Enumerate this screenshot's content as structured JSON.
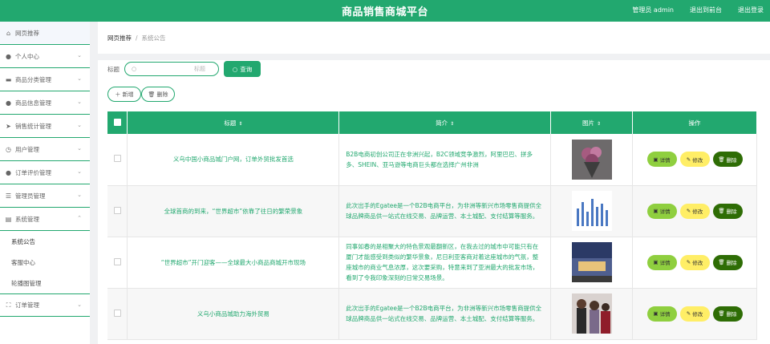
{
  "header": {
    "title": "商品销售商城平台",
    "admin": "管理员 admin",
    "exit_to_front": "退出到前台",
    "logout": "退出登录"
  },
  "sidebar": {
    "items": [
      {
        "label": "网页推荐",
        "icon": "home-icon",
        "has_chevron": false
      },
      {
        "label": "个人中心",
        "icon": "user-icon",
        "has_chevron": true
      },
      {
        "label": "商品分类管理",
        "icon": "category-icon",
        "has_chevron": true
      },
      {
        "label": "商品信息管理",
        "icon": "user-icon",
        "has_chevron": true
      },
      {
        "label": "销售统计管理",
        "icon": "send-icon",
        "has_chevron": true
      },
      {
        "label": "用户管理",
        "icon": "clock-icon",
        "has_chevron": true
      },
      {
        "label": "订单评价管理",
        "icon": "user-icon",
        "has_chevron": true
      },
      {
        "label": "管理员管理",
        "icon": "list-icon",
        "has_chevron": true
      },
      {
        "label": "系统管理",
        "icon": "doc-icon",
        "has_chevron": true,
        "expanded": true
      },
      {
        "label": "订单管理",
        "icon": "expand-icon",
        "has_chevron": true
      }
    ],
    "sub_items": [
      "系统公告",
      "客服中心",
      "轮播图管理"
    ]
  },
  "breadcrumb": {
    "home": "网页推荐",
    "separator": "/",
    "current": "系统公告"
  },
  "search": {
    "label": "标题",
    "placeholder": "标题",
    "button": "查询"
  },
  "actions": {
    "add": "＋ 新增",
    "delete": "🗑 删除"
  },
  "table": {
    "headers": {
      "title": "标题",
      "intro": "简介",
      "image": "图片",
      "ops": "操作"
    },
    "rows": [
      {
        "title": "义乌中国小商品城门户网，订单外贸批发首选",
        "intro": "B2B电商初创公司正在非洲兴起，B2C领域竞争激烈，阿里巴巴、拼多多、SHEIN、亚马逊等电商巨头都在选择广州非洲"
      },
      {
        "title": "全球首商的到来，“世界超市”依靠了往日的繁荣景象",
        "intro": "此次出手的Egatee是一个B2B电商平台，为非洲等新兴市场零售商提供全球品牌商品供一站式在线交易、品牌运营、本土城配、支付结算等服务。"
      },
      {
        "title": "“世界超市”开门迎客——全球最大小商品商城开市现场",
        "intro": "同事如春的是相聚大的特色景观最翻新区，在我去过的城市中可能只有在厦门才能感受到类似的繁华景象，尼日利亚客商对着这座城市的气氛，整座城市的商业气息浓厚，这次要采购，特意来到了亚洲最大的批发市场，看到了令我印象深刻的日常交易场景。"
      },
      {
        "title": "义乌小商品城助力海外贸易",
        "intro": "此次出手的Egatee是一个B2B电商平台，为非洲等新兴市场零售商提供全球品牌商品供一站式在线交易、品牌运营、本土城配、支付结算等服务。"
      }
    ],
    "ops": {
      "detail": "详情",
      "edit": "修改",
      "delete": "删除"
    }
  },
  "colors": {
    "brand": "#22a86f",
    "detail_btn": "#8fcf3f",
    "edit_btn": "#ffee66",
    "delete_btn": "#2e6d05"
  }
}
